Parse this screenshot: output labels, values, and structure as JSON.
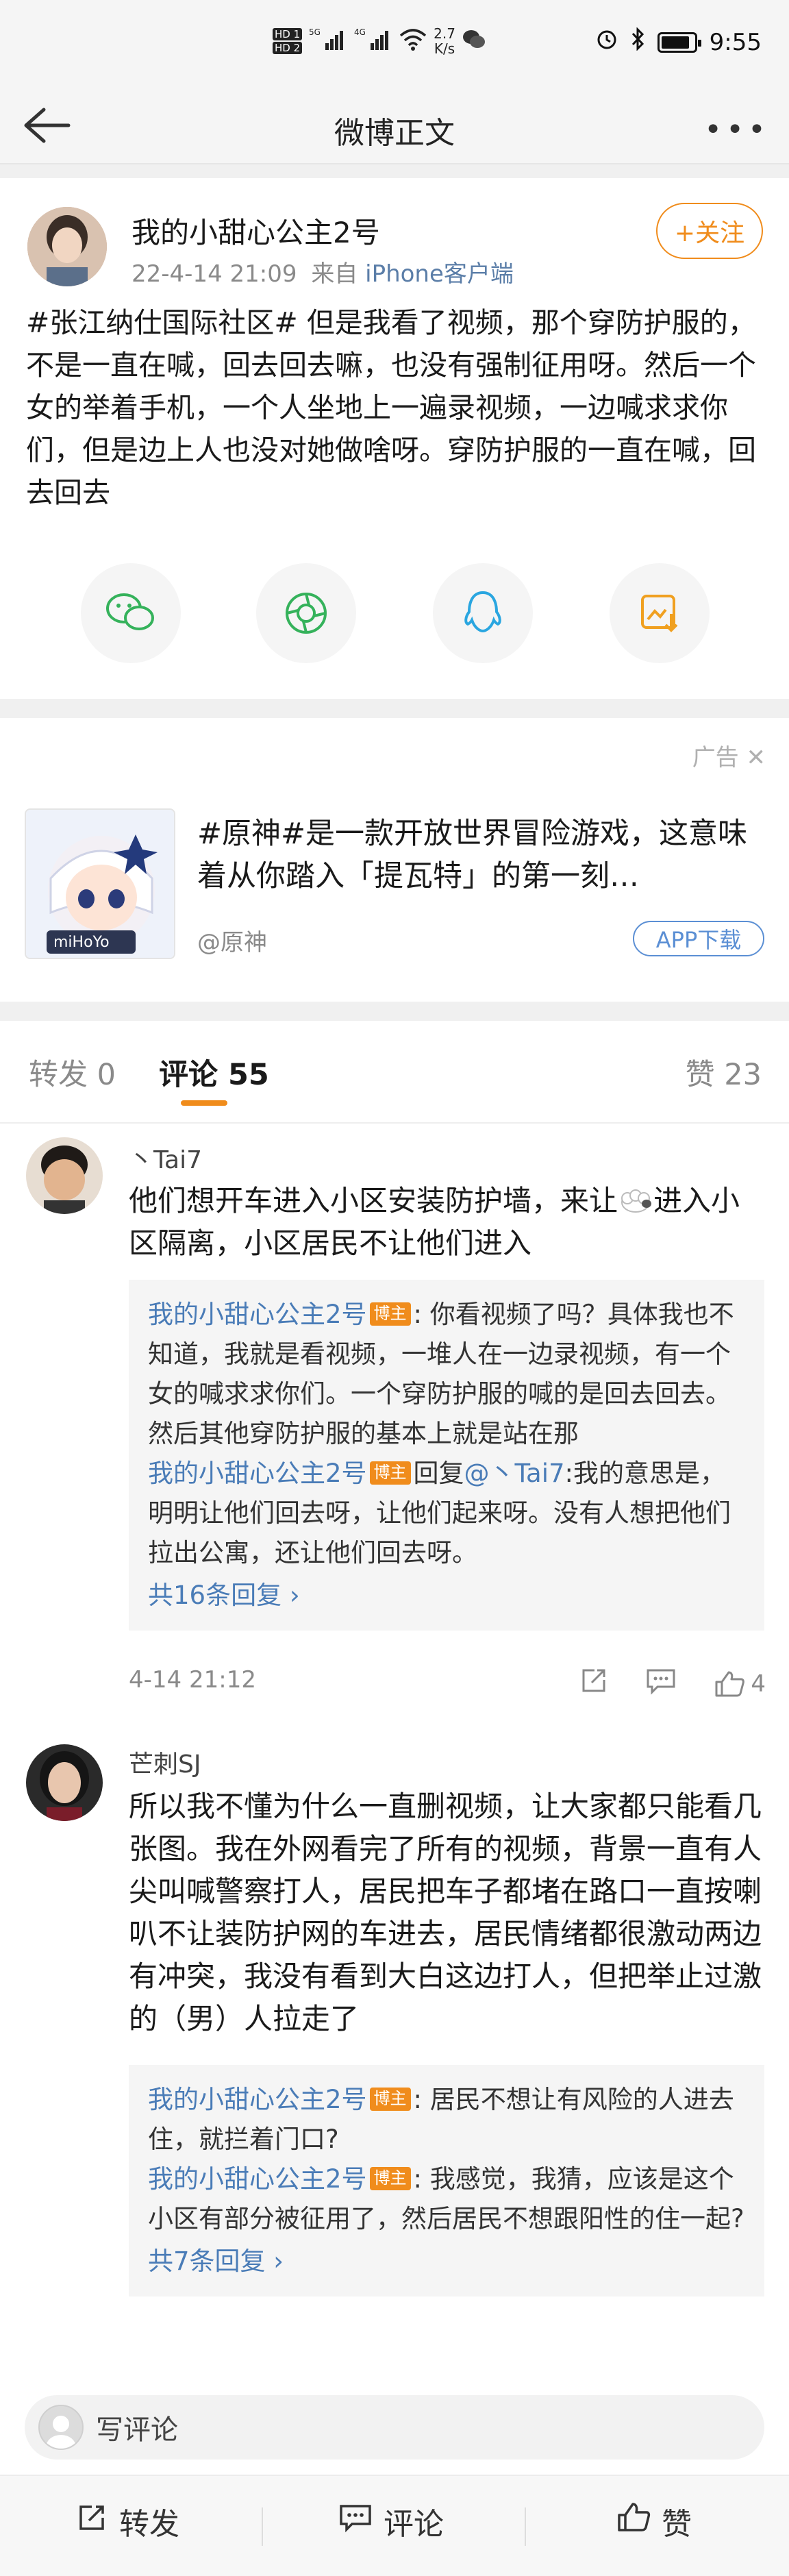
{
  "status_bar": {
    "sim1": "HD 1",
    "sim2": "HD 2",
    "net1": "5G",
    "net2": "4G",
    "speed_value": "2.7",
    "speed_unit": "K/s",
    "time": "9:55",
    "icons": [
      "wechat-icon",
      "alarm-icon",
      "bluetooth-icon",
      "battery-icon"
    ]
  },
  "navbar": {
    "title": "微博正文",
    "more": "•••"
  },
  "post": {
    "author": "我的小甜心公主2号",
    "time": "22-4-14 21:09",
    "source_prefix": "来自",
    "source": "iPhone客户端",
    "follow_label": "+关注",
    "text": "#张江纳仕国际社区# 但是我看了视频，那个穿防护服的，不是一直在喊，回去回去嘛，也没有强制征用呀。然后一个女的举着手机，一个人坐地上一遍录视频，一边喊求求你们，但是边上人也没对她做啥呀。穿防护服的一直在喊，回去回去",
    "share_icons": [
      "wechat-share-icon",
      "moments-share-icon",
      "qq-share-icon",
      "save-image-icon"
    ]
  },
  "ad": {
    "label": "广告",
    "text": "#原神#是一款开放世界冒险游戏，这意味着从你踏入「提瓦特」的第一刻…",
    "user": "@原神",
    "download_label": "APP下载",
    "logo_text": "miHoYo"
  },
  "tabs": {
    "repost": "转发 0",
    "comments": "评论 55",
    "likes": "赞 23"
  },
  "comments": [
    {
      "name": "丶Tai7",
      "text_before": "他们想开车进入小区安装防护墙，来让",
      "text_after": "进入小区隔离，小区居民不让他们进入",
      "replies": [
        {
          "name": "我的小甜心公主2号",
          "badge": "博主",
          "text": ": 你看视频了吗？具体我也不知道，我就是看视频，一堆人在一边录视频，有一个女的喊求求你们。一个穿防护服的喊的是回去回去。然后其他穿防护服的基本上就是站在那"
        },
        {
          "name": "我的小甜心公主2号",
          "badge": "博主",
          "reply_word": "回复",
          "reply_to": "@丶Tai7",
          "text": ":我的意思是，明明让他们回去呀，让他们起来呀。没有人想把他们拉出公寓，还让他们回去呀。"
        }
      ],
      "more_replies": "共16条回复 ›",
      "time": "4-14 21:12",
      "likes": "4"
    },
    {
      "name": "芒刺SJ",
      "text": "所以我不懂为什么一直删视频，让大家都只能看几张图。我在外网看完了所有的视频，背景一直有人尖叫喊警察打人，居民把车子都堵在路口一直按喇叭不让装防护网的车进去，居民情绪都很激动两边有冲突，我没有看到大白这边打人，但把举止过激的（男）人拉走了",
      "replies": [
        {
          "name": "我的小甜心公主2号",
          "badge": "博主",
          "text": ": 居民不想让有风险的人进去住，就拦着门口?"
        },
        {
          "name": "我的小甜心公主2号",
          "badge": "博主",
          "text": ": 我感觉，我猜，应该是这个小区有部分被征用了，然后居民不想跟阳性的住一起?"
        }
      ],
      "more_replies": "共7条回复 ›"
    }
  ],
  "write_bar": {
    "placeholder": "写评论"
  },
  "bottom_bar": {
    "repost": "转发",
    "comment": "评论",
    "like": "赞"
  },
  "colors": {
    "accent": "#f08c1c",
    "link": "#4a7cb7",
    "background": "#f0f0f0"
  }
}
